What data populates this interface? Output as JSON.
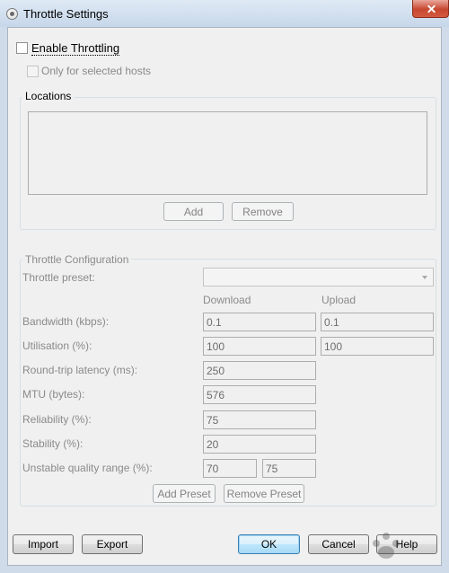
{
  "window": {
    "title": "Throttle Settings"
  },
  "enable_throttling": {
    "label": "Enable Throttling",
    "checked": false
  },
  "only_selected_hosts": {
    "label": "Only for selected hosts",
    "checked": false,
    "enabled": false
  },
  "locations": {
    "title": "Locations",
    "items": [],
    "add_label": "Add",
    "remove_label": "Remove"
  },
  "throttle_config": {
    "title": "Throttle Configuration",
    "preset_label": "Throttle preset:",
    "preset_value": "",
    "download_header": "Download",
    "upload_header": "Upload",
    "rows": {
      "bandwidth": {
        "label": "Bandwidth (kbps):",
        "download": "0.1",
        "upload": "0.1"
      },
      "utilisation": {
        "label": "Utilisation (%):",
        "download": "100",
        "upload": "100"
      },
      "latency": {
        "label": "Round-trip latency (ms):",
        "value": "250"
      },
      "mtu": {
        "label": "MTU (bytes):",
        "value": "576"
      },
      "reliability": {
        "label": "Reliability (%):",
        "value": "75"
      },
      "stability": {
        "label": "Stability (%):",
        "value": "20"
      },
      "unstable_range": {
        "label": "Unstable quality range (%):",
        "min": "70",
        "max": "75"
      }
    },
    "add_preset_label": "Add Preset",
    "remove_preset_label": "Remove Preset"
  },
  "footer": {
    "import_label": "Import",
    "export_label": "Export",
    "ok_label": "OK",
    "cancel_label": "Cancel",
    "help_label": "Help"
  }
}
